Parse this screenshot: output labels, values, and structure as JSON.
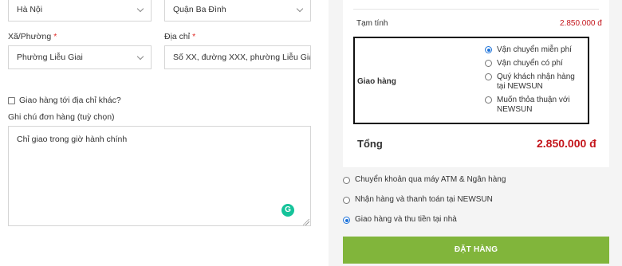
{
  "form": {
    "city_value": "Hà Nội",
    "district_value": "Quận Ba Đình",
    "ward_label": "Xã/Phường",
    "ward_value": "Phường Liễu Giai",
    "address_label": "Địa chỉ",
    "address_value": "Số XX, đường XXX, phường Liễu Giai",
    "required_mark": "*",
    "ship_other_label": "Giao hàng tới địa chỉ khác?",
    "notes_label": "Ghi chú đơn hàng (tuỳ chọn)",
    "notes_value": "Chỉ giao trong giờ hành chính",
    "grammarly_glyph": "G"
  },
  "order": {
    "subtotal_label": "Tạm tính",
    "subtotal_value": "2.850.000 đ",
    "shipping_label": "Giao hàng",
    "shipping_options": [
      {
        "label": "Vận chuyển miễn phí",
        "selected": true
      },
      {
        "label": "Vận chuyển có phí",
        "selected": false
      },
      {
        "label": "Quý khách nhận hàng tại NEWSUN",
        "selected": false
      },
      {
        "label": "Muốn thỏa thuận với NEWSUN",
        "selected": false
      }
    ],
    "total_label": "Tổng",
    "total_value": "2.850.000 đ"
  },
  "payment": {
    "options": [
      {
        "label": "Chuyển khoản qua máy ATM & Ngân hàng",
        "selected": false
      },
      {
        "label": "Nhận hàng và thanh toán tại NEWSUN",
        "selected": false
      },
      {
        "label": "Giao hàng và thu tiền tại nhà",
        "selected": true
      }
    ],
    "submit_label": "ĐẶT HÀNG"
  },
  "colors": {
    "accent_total": "#c4161c",
    "button": "#81b53b",
    "radio_selected": "#1e73d9"
  }
}
